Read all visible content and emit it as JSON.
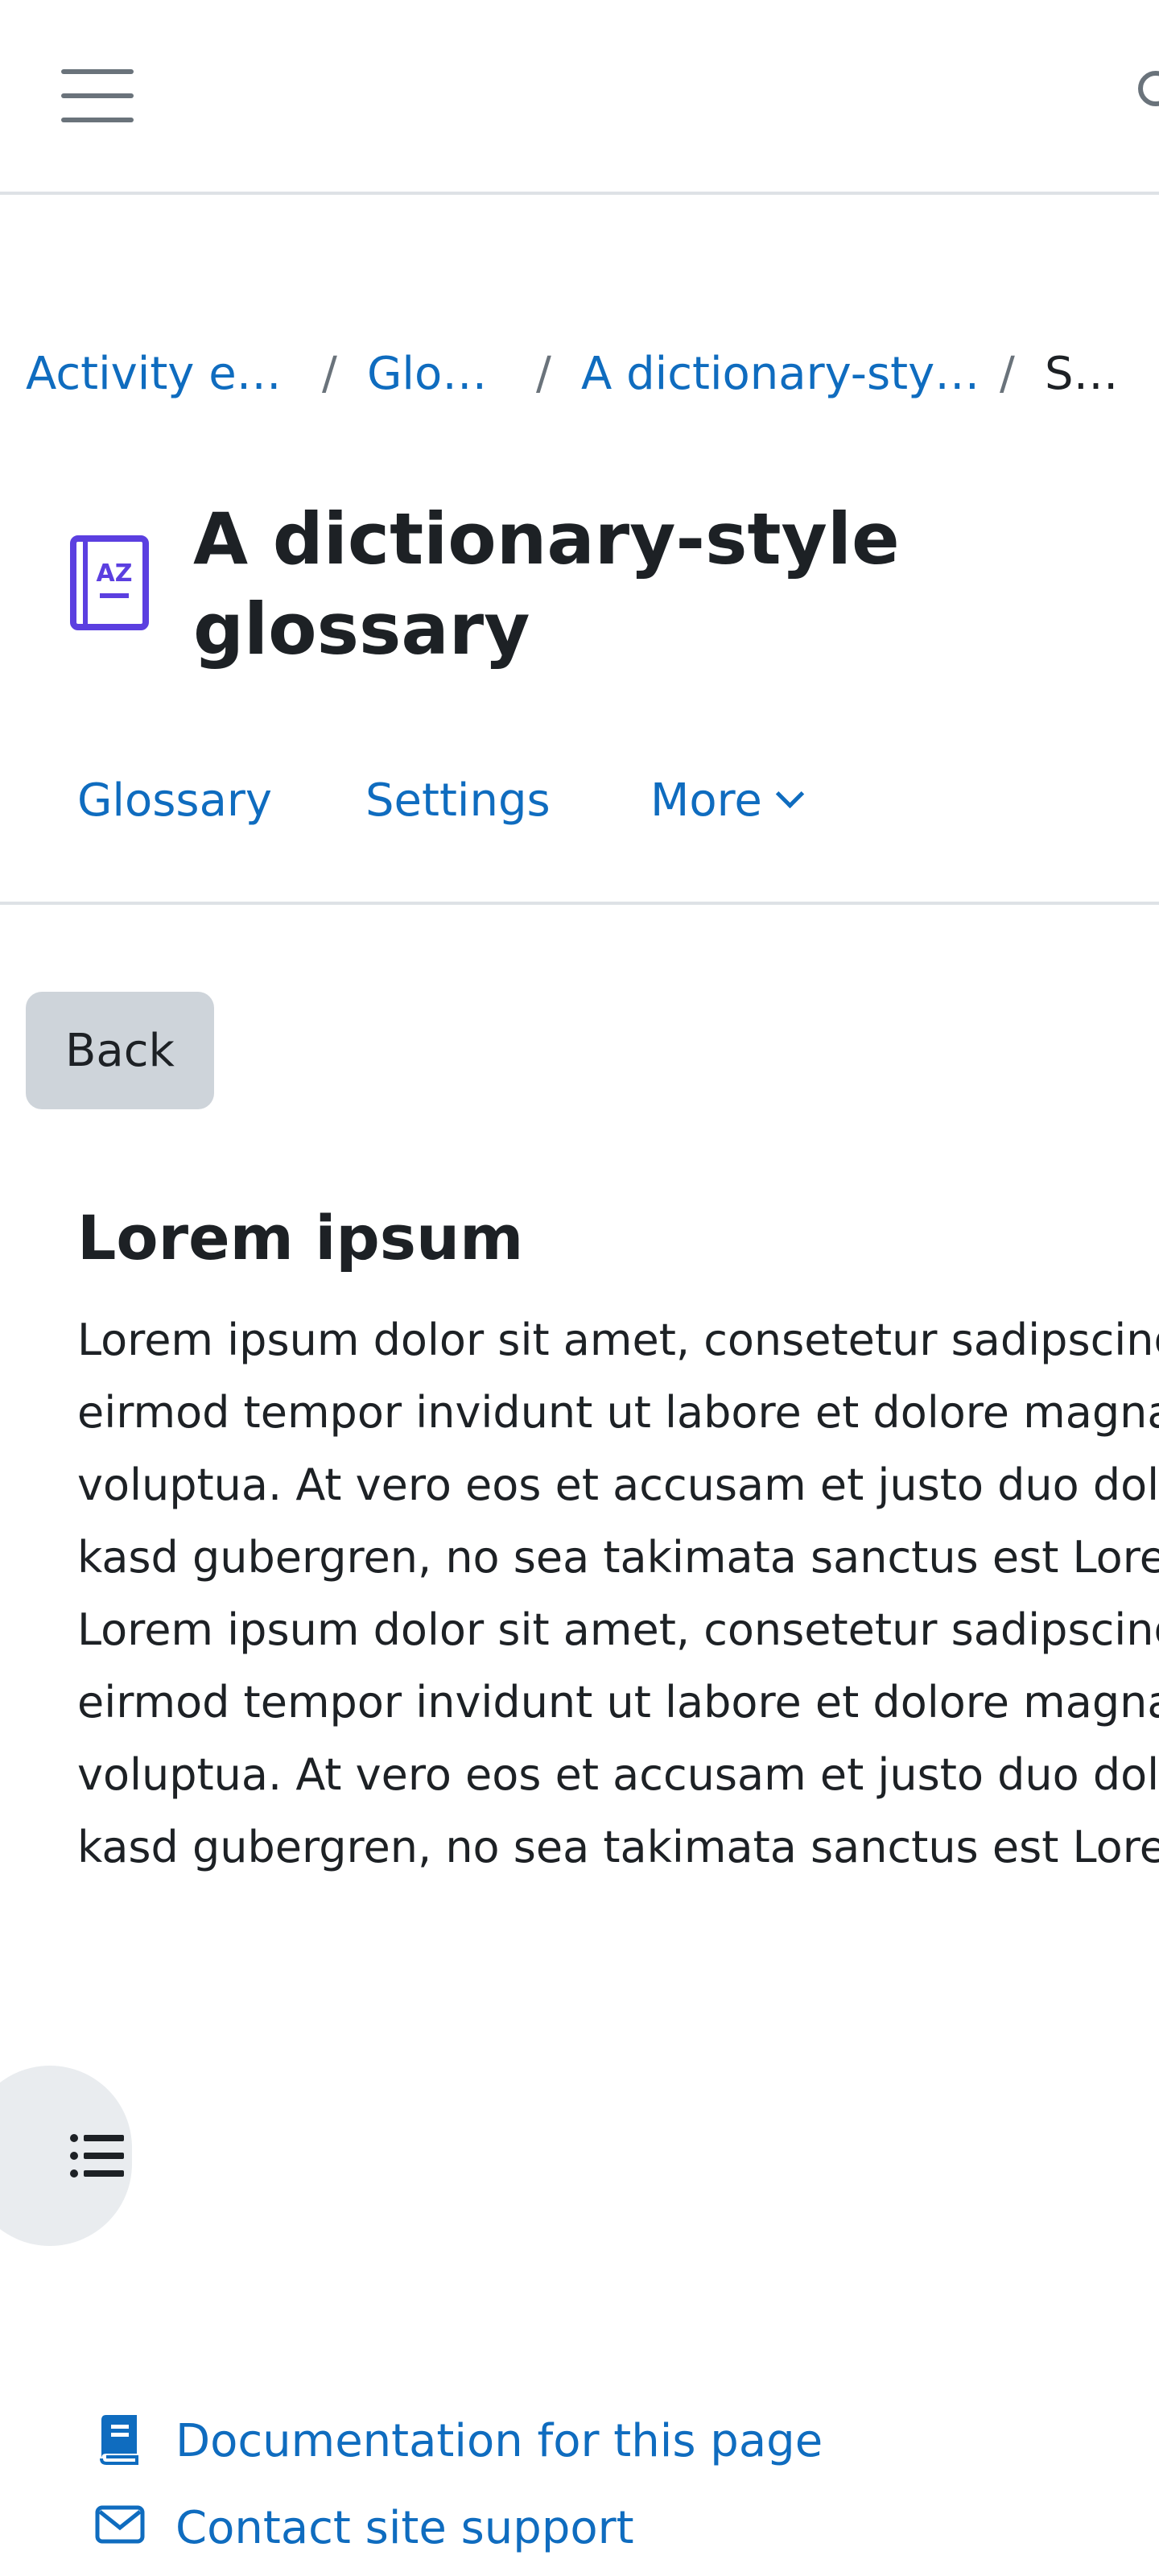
{
  "header": {
    "menu_icon": "hamburger-menu-icon",
    "search_icon": "search-icon"
  },
  "breadcrumb": [
    {
      "label": "Activity e…",
      "link": true
    },
    {
      "label": "Glo…",
      "link": true
    },
    {
      "label": "A dictionary-sty…",
      "link": true
    },
    {
      "label": "S…",
      "link": false
    }
  ],
  "breadcrumb_separator": "/",
  "page": {
    "icon": "glossary-az-icon",
    "title": "A dictionary-style glossary"
  },
  "secondary_nav": {
    "tabs": [
      "Glossary",
      "Settings",
      "More"
    ],
    "more_icon": "chevron-down-icon"
  },
  "back_button": "Back",
  "entry": {
    "title": "Lorem ipsum",
    "lines": [
      "Lorem ipsum dolor sit amet, consetetur sadipscing",
      "eirmod tempor invidunt ut labore et dolore magna",
      "voluptua. At vero eos et accusam et justo duo dolo",
      "kasd gubergren, no sea takimata sanctus est Lorem",
      "Lorem ipsum dolor sit amet, consetetur sadipscing",
      "eirmod tempor invidunt ut labore et dolore magna",
      "voluptua. At vero eos et accusam et justo duo dolo",
      "kasd gubergren, no sea takimata sanctus est Lorem"
    ]
  },
  "drawer_toggle_icon": "list-icon",
  "footer": {
    "links": [
      {
        "label": "Documentation for this page",
        "icon": "book-icon"
      },
      {
        "label": "Contact site support",
        "icon": "envelope-icon"
      }
    ]
  },
  "colors": {
    "link": "#0f6cbf",
    "activity_icon": "#5b3fe0",
    "back_button_bg": "#ced4da",
    "text": "#1d2125"
  }
}
